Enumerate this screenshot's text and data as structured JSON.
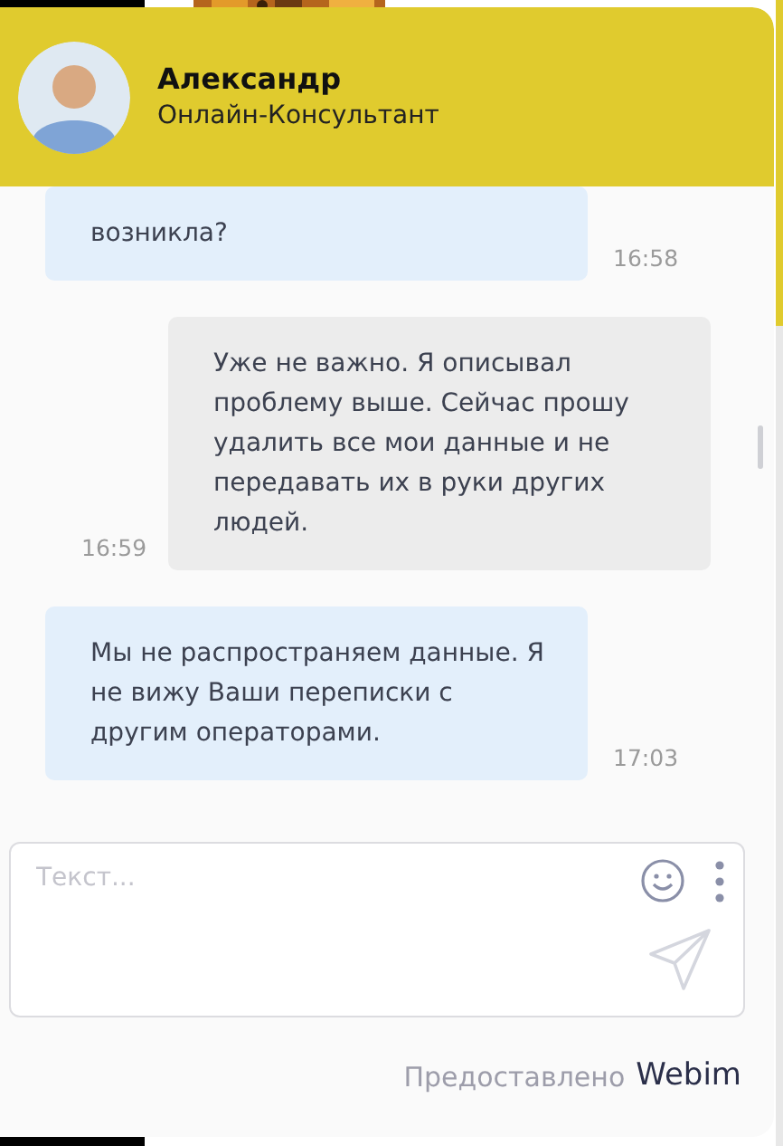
{
  "header": {
    "operator_name": "Александр",
    "operator_role": "Онлайн-Консультант"
  },
  "messages": [
    {
      "kind": "operator",
      "text": "возникла?",
      "time": "16:58"
    },
    {
      "kind": "visitor",
      "text": "Уже не важно. Я описывал проблему выше. Сейчас прошу удалить все мои данные и не передавать их в руки других людей.",
      "time": "16:59"
    },
    {
      "kind": "operator",
      "text": "Мы не распространяем данные. Я не вижу Ваши переписки с другим операторами.",
      "time": "17:03"
    }
  ],
  "composer": {
    "placeholder": "Текст..."
  },
  "footer": {
    "label": "Предоставлено",
    "brand": "Webim"
  }
}
